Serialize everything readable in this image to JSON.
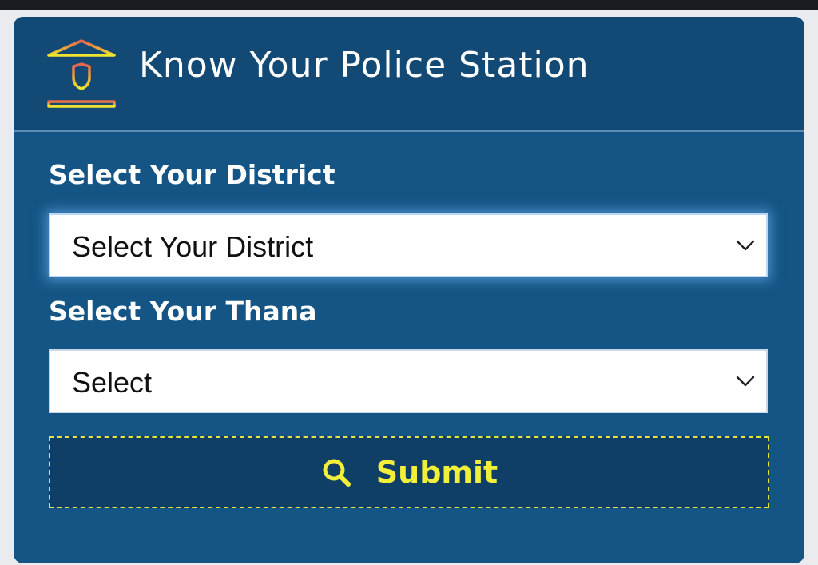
{
  "header": {
    "title": "Know Your Police Station",
    "icon": "police-station-building-icon"
  },
  "district": {
    "label": "Select Your District",
    "selected": "Select Your District"
  },
  "thana": {
    "label": "Select Your Thana",
    "selected": "Select"
  },
  "submit": {
    "label": "Submit",
    "icon": "search-icon"
  },
  "colors": {
    "card_background": "#155585",
    "header_background": "#124a75",
    "submit_text": "#f2ef3a",
    "submit_border": "#e6e33c"
  }
}
